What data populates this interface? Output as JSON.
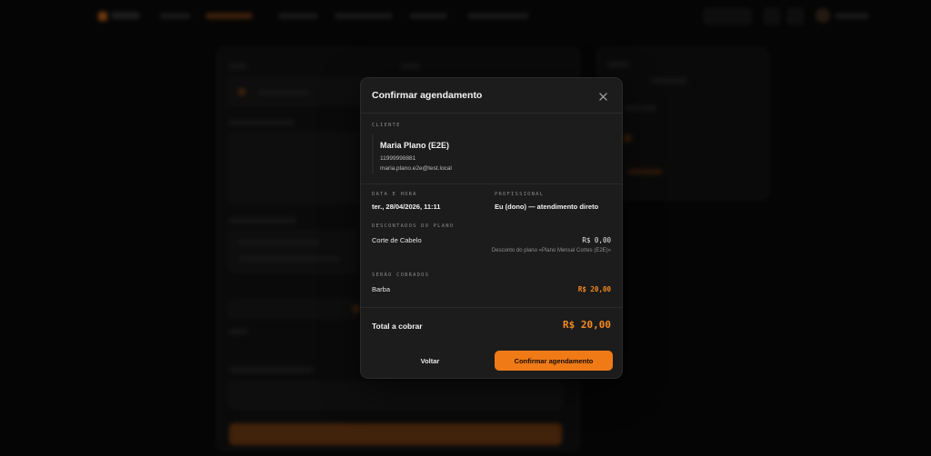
{
  "modal": {
    "title": "Confirmar agendamento",
    "close_icon": "close-icon",
    "client": {
      "label": "CLIENTE",
      "name": "Maria Plano (E2E)",
      "phone": "11999998881",
      "email": "maria.plano.e2e@test.local"
    },
    "datetime": {
      "label": "DATA E HORA",
      "value": "ter., 28/04/2026, 11:11"
    },
    "professional": {
      "label": "PROFISSIONAL",
      "value": "Eu (dono) — atendimento direto"
    },
    "plan_discounts": {
      "label": "DESCONTADOS DO PLANO",
      "items": [
        {
          "name": "Corte de Cabelo",
          "price": "R$ 0,00",
          "note": "Desconto do plano «Plano Mensal Cortes (E2E)»"
        }
      ]
    },
    "charged": {
      "label": "SERÃO COBRADOS",
      "items": [
        {
          "name": "Barba",
          "price": "R$ 20,00"
        }
      ]
    },
    "total": {
      "label": "Total a cobrar",
      "value": "R$ 20,00"
    },
    "buttons": {
      "back": "Voltar",
      "confirm": "Confirmar agendamento"
    }
  },
  "colors": {
    "accent": "#f07a16",
    "price_orange": "#f28a22",
    "modal_bg": "#1c1c1c",
    "backdrop": "#050505"
  }
}
